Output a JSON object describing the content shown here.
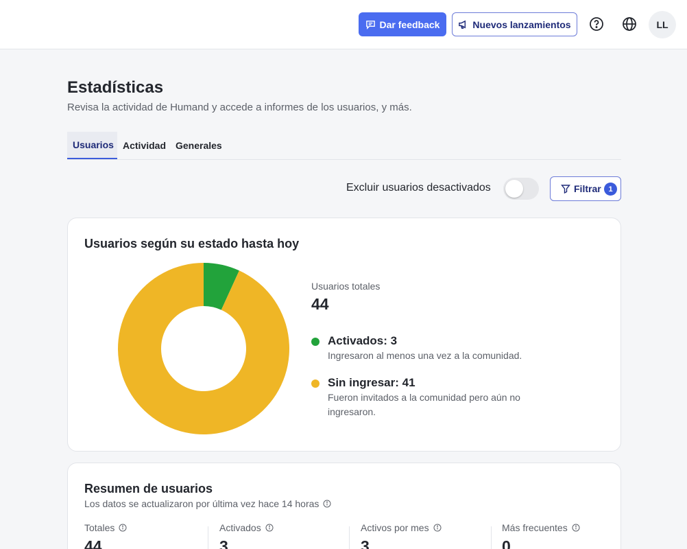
{
  "header": {
    "feedback_label": "Dar feedback",
    "releases_label": "Nuevos lanzamientos",
    "help_icon": "question-circle-icon",
    "language_icon": "globe-icon",
    "avatar_initials": "LL",
    "brand_color": "#4a6cf0"
  },
  "page": {
    "title": "Estadísticas",
    "subtitle": "Revisa la actividad de Humand y accede a informes de los usuarios, y más."
  },
  "tabs": [
    {
      "label": "Usuarios",
      "active": true
    },
    {
      "label": "Actividad",
      "active": false
    },
    {
      "label": "Generales",
      "active": false
    }
  ],
  "filters": {
    "exclude_label": "Excluir usuarios desactivados",
    "exclude_enabled": false,
    "filter_label": "Filtrar",
    "filter_count": "1"
  },
  "status_card": {
    "title": "Usuarios según su estado hasta hoy",
    "total_label": "Usuarios totales",
    "total_value": "44",
    "items": [
      {
        "title": "Activados: 3",
        "description": "Ingresaron al menos una vez a la comunidad.",
        "color": "#22a33b"
      },
      {
        "title": "Sin ingresar: 41",
        "description": "Fueron invitados a la comunidad pero aún no ingresaron.",
        "color": "#efb626"
      }
    ]
  },
  "chart_data": {
    "type": "pie",
    "categories": [
      "Activados",
      "Sin ingresar"
    ],
    "values": [
      3,
      41
    ],
    "colors": [
      "#22a33b",
      "#efb626"
    ]
  },
  "summary_card": {
    "title": "Resumen de usuarios",
    "subtitle": "Los datos se actualizaron por última vez hace 14 horas",
    "stats": [
      {
        "label": "Totales",
        "value": "44"
      },
      {
        "label": "Activados",
        "value": "3"
      },
      {
        "label": "Activos por mes",
        "value": "3"
      },
      {
        "label": "Más frecuentes",
        "value": "0"
      }
    ]
  }
}
